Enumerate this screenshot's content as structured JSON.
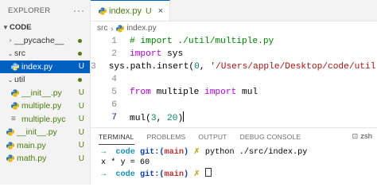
{
  "explorer": {
    "title": "EXPLORER",
    "more": "···",
    "folder_name": "CODE",
    "items": [
      {
        "label": "__pycache__",
        "badge": ""
      },
      {
        "label": "src",
        "badge": ""
      },
      {
        "label": "index.py",
        "badge": "U"
      },
      {
        "label": "util",
        "badge": ""
      },
      {
        "label": "__init__.py",
        "badge": "U"
      },
      {
        "label": "multiple.py",
        "badge": "U"
      },
      {
        "label": "multiple.pyc",
        "badge": "U"
      },
      {
        "label": "__init__.py",
        "badge": "U"
      },
      {
        "label": "main.py",
        "badge": "U"
      },
      {
        "label": "math.py",
        "badge": "U"
      }
    ]
  },
  "editor": {
    "tab_label": "index.py",
    "tab_badge": "U",
    "tab_close": "×",
    "breadcrumb": [
      "src",
      "index.py"
    ],
    "line_numbers": [
      "1",
      "2",
      "3",
      "4",
      "5",
      "6",
      "7"
    ],
    "lines": {
      "l1": "# import ./util/multiple.py",
      "l2_kw": "import",
      "l2_rest": " sys",
      "l3_a": "sys.path.insert(",
      "l3_num": "0",
      "l3_b": ", ",
      "l3_str": "'/Users/apple/Desktop/code/util'",
      "l3_c": ")",
      "l5_kw1": "from",
      "l5_mid": " multiple ",
      "l5_kw2": "import",
      "l5_end": " mul",
      "l7_a": "mul(",
      "l7_n1": "3",
      "l7_b": ", ",
      "l7_n2": "20",
      "l7_c": ")"
    }
  },
  "panel": {
    "tabs": [
      "TERMINAL",
      "PROBLEMS",
      "OUTPUT",
      "DEBUG CONSOLE"
    ],
    "terminal_name": "zsh",
    "terminal": {
      "arrow": "→",
      "dir": "code",
      "git": "git:(",
      "branch": "main",
      "git_close": ")",
      "x": "✗",
      "cmd": "python ./src/index.py",
      "output": "x * y = 60"
    }
  }
}
